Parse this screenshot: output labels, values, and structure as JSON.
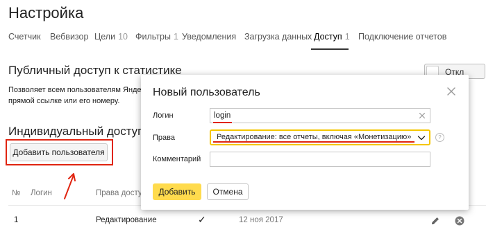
{
  "page": {
    "title": "Настройка"
  },
  "tabs": [
    {
      "label": "Счетчик",
      "count": ""
    },
    {
      "label": "Вебвизор",
      "count": ""
    },
    {
      "label": "Цели",
      "count": "10"
    },
    {
      "label": "Фильтры",
      "count": "1"
    },
    {
      "label": "Уведомления",
      "count": ""
    },
    {
      "label": "Загрузка данных",
      "count": ""
    },
    {
      "label": "Доступ",
      "count": "1",
      "active": true
    },
    {
      "label": "Подключение отчетов",
      "count": ""
    }
  ],
  "public_access": {
    "title": "Публичный доступ к статистике",
    "desc_line1": "Позволяет всем пользователям Яндекс",
    "desc_line2": "прямой ссылке или его номеру.",
    "toggle_label": "Откл"
  },
  "individual_access": {
    "title": "Индивидуальный доступ",
    "add_button": "Добавить пользователя"
  },
  "table": {
    "headers": {
      "num": "№",
      "login": "Логин",
      "rights": "Права доступа"
    },
    "rows": [
      {
        "num": "1",
        "rights": "Редактирование",
        "check": "✓",
        "date": "12 ноя 2017"
      }
    ]
  },
  "modal": {
    "title": "Новый пользователь",
    "login_label": "Логин",
    "login_value": "login",
    "rights_label": "Права",
    "rights_value": "Редактирование: все отчеты, включая «Монетизацию»",
    "help_mark": "?",
    "comment_label": "Комментарий",
    "comment_value": "",
    "add_button": "Добавить",
    "cancel_button": "Отмена"
  },
  "colors": {
    "accent_yellow": "#ffdb4d",
    "select_border": "#f5c600",
    "annotation_red": "#e02410"
  }
}
